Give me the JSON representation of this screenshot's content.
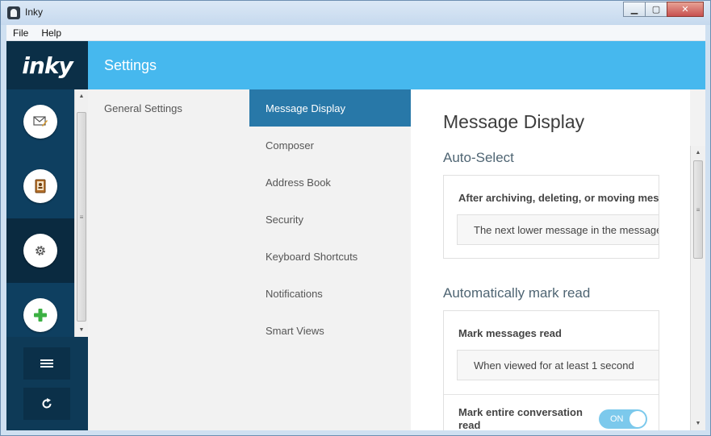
{
  "window": {
    "title": "Inky",
    "minimize_glyph": "▁",
    "maximize_glyph": "▢",
    "close_glyph": "✕"
  },
  "menubar": {
    "items": [
      "File",
      "Help"
    ]
  },
  "logo": "inky",
  "header": {
    "title": "Settings"
  },
  "rail": {
    "icons": [
      "mail-compose-icon",
      "address-book-icon",
      "settings-gear-icon",
      "add-account-icon"
    ],
    "active_index": 2,
    "bottom_icons": [
      "hamburger-menu-icon",
      "refresh-icon"
    ]
  },
  "scroll_glyphs": {
    "up": "▲",
    "down": "▼",
    "grip": "≡"
  },
  "categories": [
    "General Settings"
  ],
  "subcategories": [
    "Message Display",
    "Composer",
    "Address Book",
    "Security",
    "Keyboard Shortcuts",
    "Notifications",
    "Smart Views"
  ],
  "active_subcategory": "Message Display",
  "content": {
    "title": "Message Display",
    "sections": [
      {
        "heading": "Auto-Select",
        "label": "After archiving, deleting, or moving messages",
        "value": "The next lower message in the message list"
      },
      {
        "heading": "Automatically mark read",
        "label": "Mark messages read",
        "value": "When viewed for at least 1 second",
        "toggle_label": "Mark entire conversation read",
        "toggle_value": "ON"
      }
    ]
  },
  "colors": {
    "header": "#46b8ee",
    "rail": "#0e3a57",
    "active_subcategory": "#2878a8",
    "toggle": "#7cc9ec",
    "plus_icon": "#3cb043"
  }
}
